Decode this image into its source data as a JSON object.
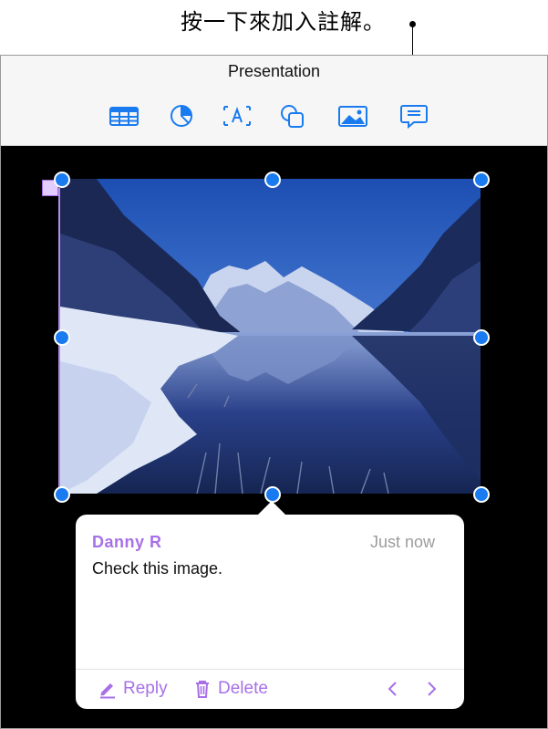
{
  "callout": {
    "text": "按一下來加入註解。"
  },
  "app": {
    "title": "Presentation"
  },
  "toolbar": {
    "tools": [
      {
        "name": "table-icon"
      },
      {
        "name": "chart-icon"
      },
      {
        "name": "text-box-icon"
      },
      {
        "name": "shapes-icon"
      },
      {
        "name": "media-icon"
      },
      {
        "name": "comment-icon"
      }
    ],
    "accent_color": "#1a7bf0"
  },
  "comment": {
    "author": "Danny R",
    "time": "Just now",
    "body": "Check this image.",
    "reply_label": "Reply",
    "delete_label": "Delete",
    "author_color": "#a770e8"
  }
}
